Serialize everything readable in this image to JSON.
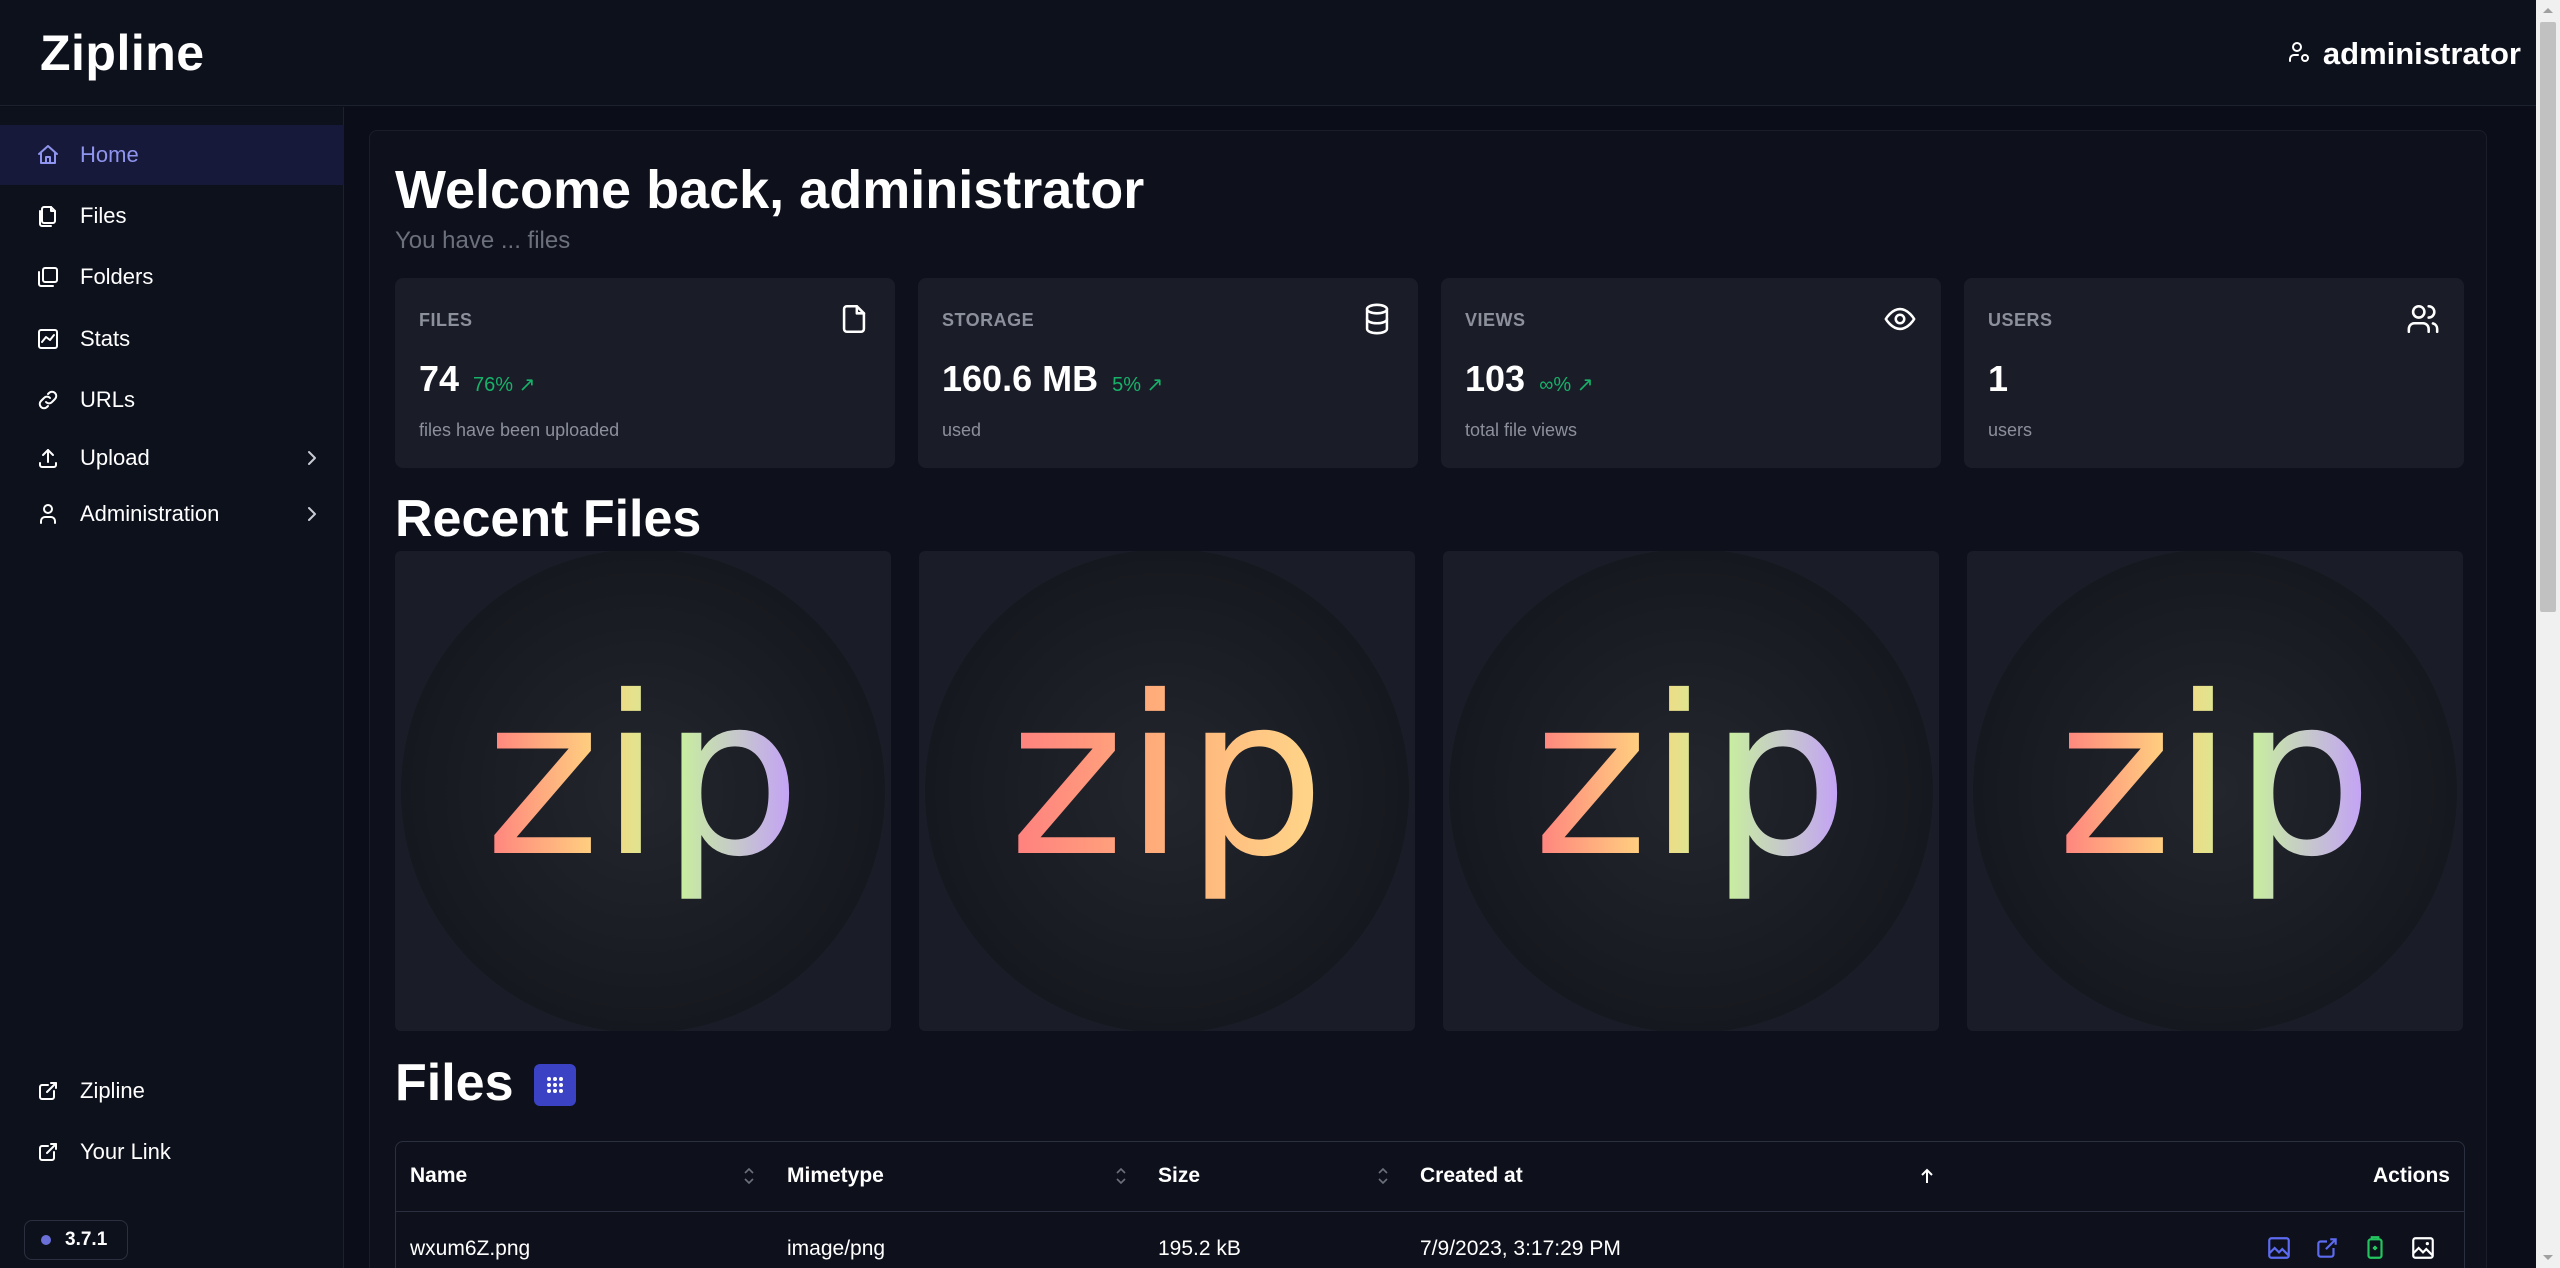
{
  "header": {
    "brand": "Zipline",
    "username": "administrator"
  },
  "sidebar": {
    "items": [
      {
        "label": "Home",
        "icon": "home-icon",
        "active": true
      },
      {
        "label": "Files",
        "icon": "files-icon"
      },
      {
        "label": "Folders",
        "icon": "folders-icon"
      },
      {
        "label": "Stats",
        "icon": "stats-icon"
      },
      {
        "label": "URLs",
        "icon": "link-icon"
      },
      {
        "label": "Upload",
        "icon": "upload-icon",
        "expandable": true
      },
      {
        "label": "Administration",
        "icon": "user-icon",
        "expandable": true
      }
    ],
    "bottom_items": [
      {
        "label": "Zipline",
        "icon": "external-link-icon"
      },
      {
        "label": "Your Link",
        "icon": "external-link-icon"
      }
    ],
    "version": "3.7.1"
  },
  "main": {
    "welcome": "Welcome back, administrator",
    "subtitle": "You have ... files",
    "stats": [
      {
        "label": "FILES",
        "value": "74",
        "delta": "76%",
        "caption": "files have been uploaded",
        "icon": "file-icon"
      },
      {
        "label": "STORAGE",
        "value": "160.6 MB",
        "delta": "5%",
        "caption": "used",
        "icon": "database-icon"
      },
      {
        "label": "VIEWS",
        "value": "103",
        "delta": "∞%",
        "caption": "total file views",
        "icon": "eye-icon"
      },
      {
        "label": "USERS",
        "value": "1",
        "delta": "",
        "caption": "users",
        "icon": "users-icon"
      }
    ],
    "recent_title": "Recent Files",
    "recent_files": [
      {
        "thumbnail_text": "zip"
      },
      {
        "thumbnail_text": "zip"
      },
      {
        "thumbnail_text": "zip"
      },
      {
        "thumbnail_text": "zip"
      }
    ],
    "files_title": "Files",
    "table": {
      "columns": [
        "Name",
        "Mimetype",
        "Size",
        "Created at",
        "Actions"
      ],
      "rows": [
        {
          "name": "wxum6Z.png",
          "mimetype": "image/png",
          "size": "195.2 kB",
          "created_at": "7/9/2023, 3:17:29 PM"
        }
      ]
    }
  },
  "colors": {
    "accent": "#8f94ee",
    "active_bg": "#17193a",
    "delta_green": "#17b26a",
    "action_blue": "#5c6bf0",
    "action_green": "#22c55e"
  }
}
